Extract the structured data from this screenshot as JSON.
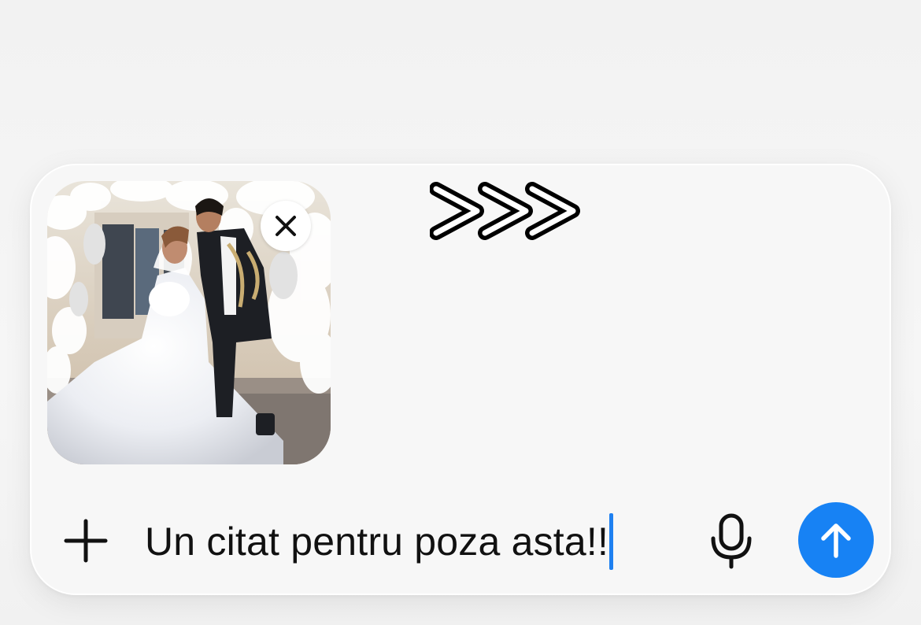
{
  "composer": {
    "message_text": "Un citat pentru poza asta!!",
    "attachment": {
      "kind": "photo",
      "subject": "wedding couple"
    },
    "icons": {
      "remove": "close-icon",
      "sticker": "triple-chevron-sticker",
      "add": "plus-icon",
      "voice": "microphone-icon",
      "send": "arrow-up-icon"
    },
    "colors": {
      "accent": "#1782f4",
      "caret": "#1f80f0"
    }
  }
}
